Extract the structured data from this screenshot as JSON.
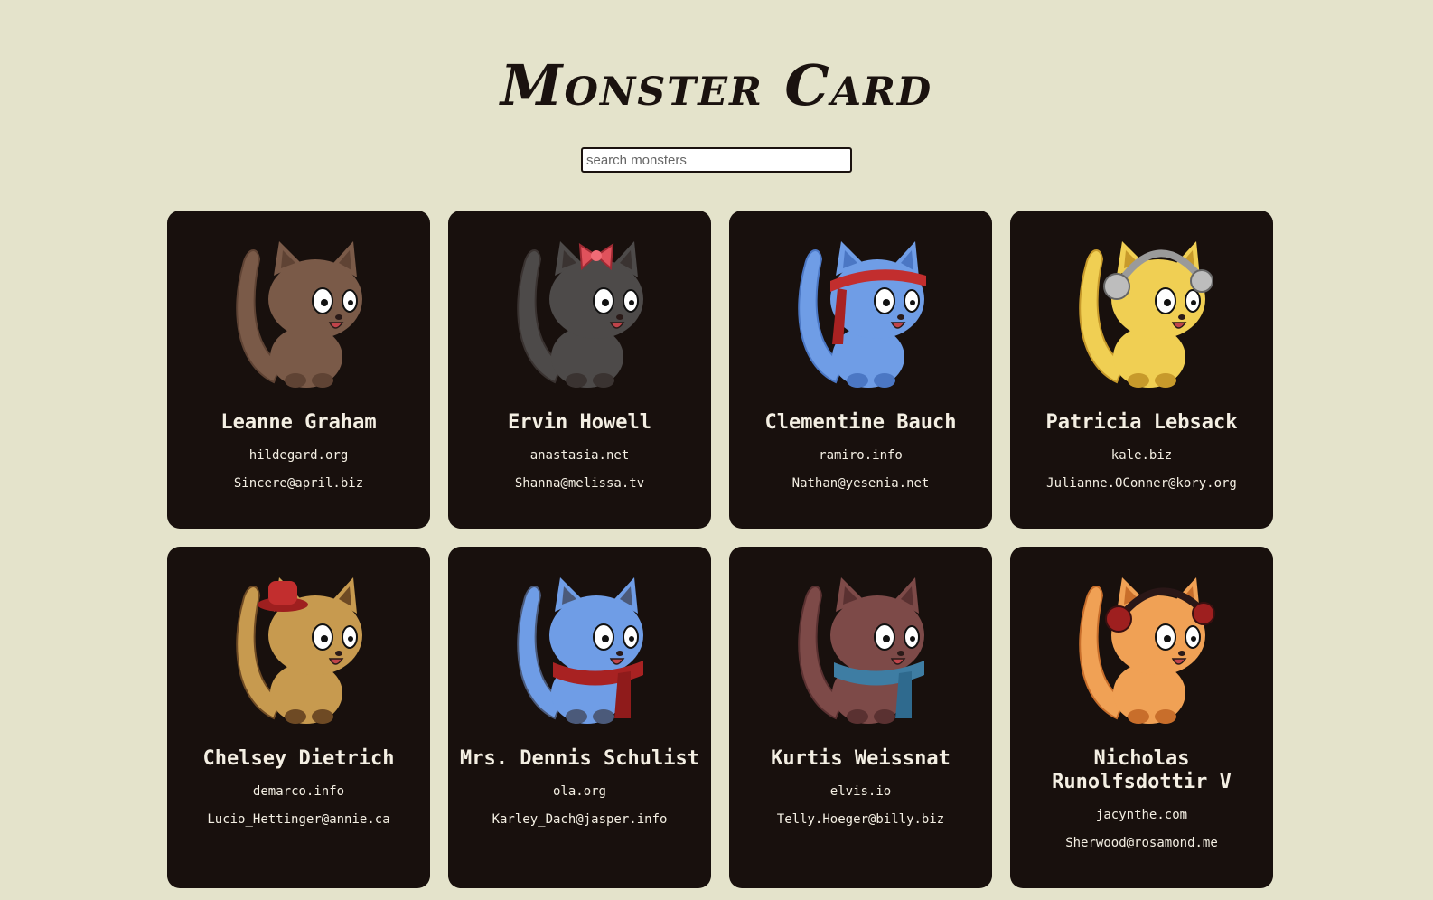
{
  "page": {
    "title": "Monster Card",
    "search_placeholder": "search monsters"
  },
  "colors": {
    "background": "#e4e3cb",
    "card": "#18100d",
    "card_text": "#f4efe3"
  },
  "monsters": [
    {
      "name": "Leanne Graham",
      "website": "hildegard.org",
      "email": "Sincere@april.biz",
      "body": "#7a5a48",
      "accent": "#5f4334",
      "accessory": "none"
    },
    {
      "name": "Ervin Howell",
      "website": "anastasia.net",
      "email": "Shanna@melissa.tv",
      "body": "#4d4a49",
      "accent": "#3a3331",
      "accessory": "bow"
    },
    {
      "name": "Clementine Bauch",
      "website": "ramiro.info",
      "email": "Nathan@yesenia.net",
      "body": "#6f9de6",
      "accent": "#4b77c4",
      "accessory": "headband"
    },
    {
      "name": "Patricia Lebsack",
      "website": "kale.biz",
      "email": "Julianne.OConner@kory.org",
      "body": "#f0cf53",
      "accent": "#c79a2b",
      "accessory": "headphones-grey"
    },
    {
      "name": "Chelsey Dietrich",
      "website": "demarco.info",
      "email": "Lucio_Hettinger@annie.ca",
      "body": "#c79a4f",
      "accent": "#6e4a24",
      "accessory": "hat"
    },
    {
      "name": "Mrs. Dennis Schulist",
      "website": "ola.org",
      "email": "Karley_Dach@jasper.info",
      "body": "#6f9de6",
      "accent": "#4b5a7a",
      "accessory": "scarf-red"
    },
    {
      "name": "Kurtis Weissnat",
      "website": "elvis.io",
      "email": "Telly.Hoeger@billy.biz",
      "body": "#7d4a48",
      "accent": "#5a3131",
      "accessory": "scarf-blue"
    },
    {
      "name": "Nicholas Runolfsdottir V",
      "website": "jacynthe.com",
      "email": "Sherwood@rosamond.me",
      "body": "#f0a155",
      "accent": "#c86e2b",
      "accessory": "headphones-red"
    }
  ]
}
